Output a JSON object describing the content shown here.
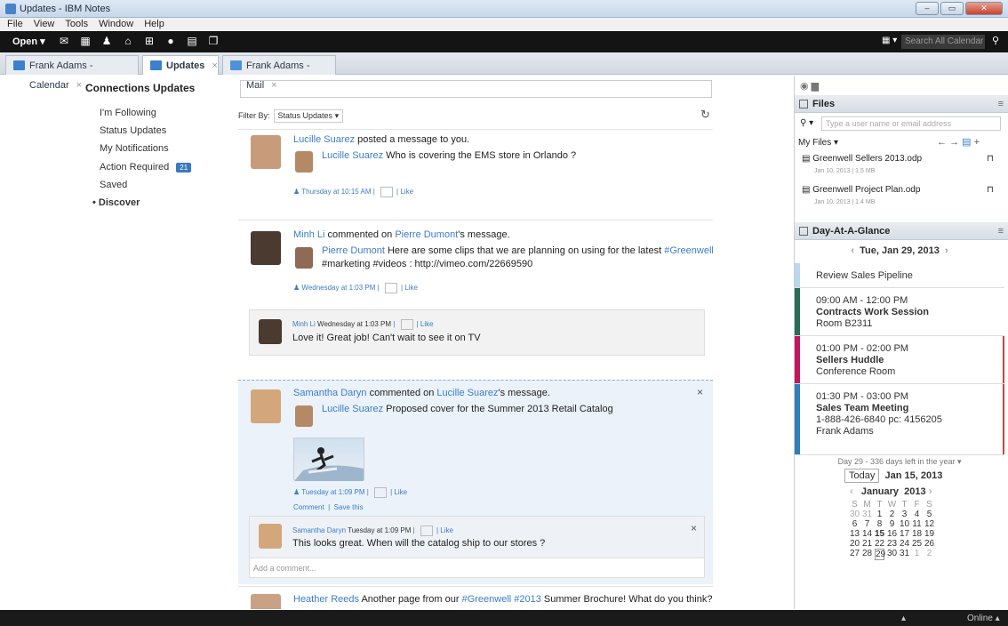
{
  "window": {
    "title": "Updates - IBM Notes"
  },
  "menu": [
    "File",
    "View",
    "Tools",
    "Window",
    "Help"
  ],
  "toolbar": {
    "open": "Open ▾",
    "search_placeholder": "Search All Calendar"
  },
  "tabs": [
    {
      "label": "Frank Adams - Calendar",
      "color": "#3d7fcf"
    },
    {
      "label": "Updates",
      "color": "#3d7fcf"
    },
    {
      "label": "Frank Adams - Mail",
      "color": "#3d7fcf"
    }
  ],
  "left": {
    "header": "Connections Updates",
    "items": [
      "I'm Following",
      "Status Updates",
      "My Notifications",
      "Action Required",
      "Saved",
      "Discover"
    ],
    "badge": "21"
  },
  "feed": {
    "filter_label": "Filter By:",
    "filter_value": "Status Updates",
    "p1": {
      "author": "Lucille Suarez",
      "action": " posted a message to you.",
      "inner_author": "Lucille Suarez",
      "inner_text": " Who is covering the EMS store in Orlando ?",
      "time": "Thursday at 10:15 AM",
      "like": "Like"
    },
    "p2": {
      "author": "Minh Li",
      "action": " commented on ",
      "target": "Pierre Dumont",
      "action2": "'s message.",
      "inner_author": "Pierre Dumont",
      "inner_text": " Here are some clips that we are planning on using for the latest ",
      "inner_tag": "#Greenwell",
      "inner_line2": "#marketing #videos : http://vimeo.com/22669590",
      "time": "Wednesday at 1:03 PM",
      "like": "Like",
      "reply_author": "Minh Li",
      "reply_time": "Wednesday at 1:03 PM",
      "reply_like": "Like",
      "reply_text": "Love it! Great job! Can't wait to see it on TV"
    },
    "p3": {
      "author": "Samantha Daryn",
      "action": " commented on ",
      "target": "Lucille Suarez",
      "action2": "'s message.",
      "inner_author": "Lucille Suarez",
      "inner_text": " Proposed cover for the Summer 2013 Retail Catalog",
      "time": "Tuesday at 1:09 PM",
      "like": "Like",
      "comment": "Comment",
      "save": "Save this",
      "reply_author": "Samantha Daryn",
      "reply_time": "Tuesday at 1:09 PM",
      "reply_like": "Like",
      "reply_text": "This looks great. When will the catalog ship to our stores ?",
      "add_comment": "Add a comment..."
    },
    "p4": {
      "author": "Heather Reeds",
      "text": " Another page from our ",
      "tag1": "#Greenwell",
      "tag2": "#2013",
      "text2": " Summer Brochure! What do you think?"
    }
  },
  "files": {
    "title": "Files",
    "search_placeholder": "Type a user name or email address",
    "myfiles": "My Files ▾",
    "items": [
      {
        "name": "Greenwell Sellers 2013.odp",
        "meta": "Jan 10, 2013  |  1.5 MB"
      },
      {
        "name": "Greenwell Project Plan.odp",
        "meta": "Jan 10, 2013  |  1.4 MB"
      }
    ]
  },
  "glance": {
    "title": "Day-At-A-Glance",
    "date": "Tue, Jan 29, 2013",
    "first": "Review Sales Pipeline",
    "events": [
      {
        "time": "09:00 AM - 12:00 PM",
        "title": "Contracts Work Session",
        "loc": "Room B2311",
        "extra": "",
        "person": "",
        "color": "#2a6b5a"
      },
      {
        "time": "01:00 PM - 02:00 PM",
        "title": "Sellers Huddle",
        "loc": "Conference Room",
        "extra": "",
        "person": "",
        "color": "#c2185b"
      },
      {
        "time": "01:30 PM - 03:00 PM",
        "title": "Sales Team Meeting",
        "loc": "1-888-426-6840 pc: 4156205",
        "extra": "",
        "person": "Frank Adams",
        "color": "#2f7fbf"
      }
    ],
    "footer": "Day 29 - 336 days left in the year ▾"
  },
  "mini": {
    "today": "Today",
    "todaydate": "Jan 15, 2013",
    "month": "January",
    "year": "2013",
    "dow": [
      "S",
      "M",
      "T",
      "W",
      "T",
      "F",
      "S"
    ],
    "weeks": [
      [
        "30",
        "31",
        "1",
        "2",
        "3",
        "4",
        "5"
      ],
      [
        "6",
        "7",
        "8",
        "9",
        "10",
        "11",
        "12"
      ],
      [
        "13",
        "14",
        "15",
        "16",
        "17",
        "18",
        "19"
      ],
      [
        "20",
        "21",
        "22",
        "23",
        "24",
        "25",
        "26"
      ],
      [
        "27",
        "28",
        "29",
        "30",
        "31",
        "1",
        "2"
      ]
    ]
  },
  "status": {
    "online": "Online ▴"
  }
}
